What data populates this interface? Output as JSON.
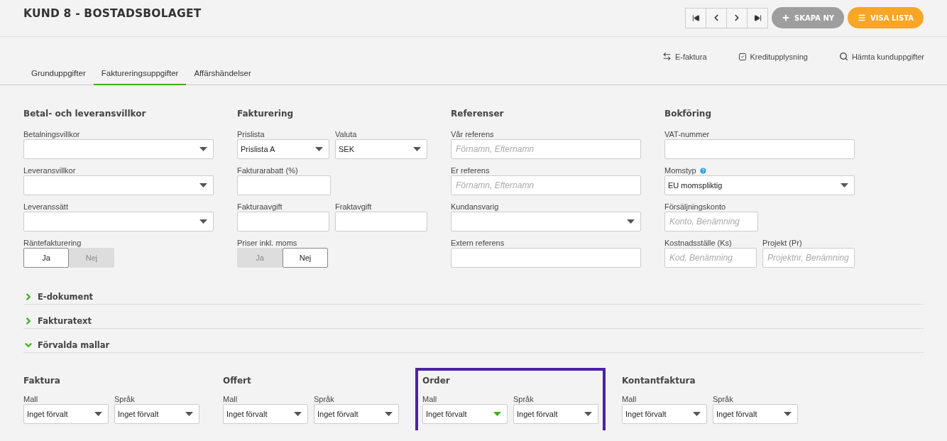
{
  "header": {
    "title": "KUND 8 - BOSTADSBOLAGET",
    "create_button": "SKAPA NY",
    "list_button": "VISA LISTA"
  },
  "actions": [
    {
      "kind": "transfer",
      "label": "E-faktura"
    },
    {
      "kind": "check",
      "label": "Kreditupplysning"
    },
    {
      "kind": "search",
      "label": "Hämta kunduppgifter"
    }
  ],
  "tabs": [
    {
      "label": "Grunduppgifter",
      "selected": false
    },
    {
      "label": "Faktureringsuppgifter",
      "selected": true
    },
    {
      "label": "Affärshändelser",
      "selected": false
    }
  ],
  "sections": [
    {
      "title": "Betal- och leveransvillkor",
      "kind": "single",
      "rows": [
        [
          {
            "label": "Betalningsvillkor",
            "kind": "select"
          }
        ],
        [
          {
            "label": "Leveransvillkor",
            "kind": "select"
          }
        ],
        [
          {
            "label": "Leveranssätt",
            "kind": "select"
          }
        ],
        [
          {
            "label": "Räntefakturering",
            "kind": "toggle",
            "options": [
              {
                "label": "Ja",
                "selected": true
              },
              {
                "label": "Nej",
                "selected": false
              }
            ]
          }
        ]
      ]
    },
    {
      "title": "Fakturering",
      "kind": "double",
      "rows": [
        [
          {
            "label": "Prislista",
            "kind": "select",
            "value": "Prislista A"
          },
          {
            "label": "Valuta",
            "kind": "select",
            "value": "SEK"
          }
        ],
        [
          {
            "label": "Fakturarabatt (%)",
            "kind": "text"
          }
        ],
        [
          {
            "label": "Fakturaavgift",
            "kind": "text"
          },
          {
            "label": "Fraktavgift",
            "kind": "text"
          }
        ],
        [
          {
            "label": "Priser inkl. moms",
            "kind": "toggle",
            "options": [
              {
                "label": "Ja",
                "selected": false
              },
              {
                "label": "Nej",
                "selected": true
              }
            ]
          }
        ]
      ]
    },
    {
      "title": "Referenser",
      "kind": "single",
      "rows": [
        [
          {
            "label": "Vår referens",
            "kind": "text",
            "placeholder": "Förnamn, Efternamn"
          }
        ],
        [
          {
            "label": "Er referens",
            "kind": "text",
            "placeholder": "Förnamn, Efternamn"
          }
        ],
        [
          {
            "label": "Kundansvarig",
            "kind": "select"
          }
        ],
        [
          {
            "label": "Extern referens",
            "kind": "text"
          }
        ]
      ]
    },
    {
      "title": "Bokföring",
      "kind": "double",
      "rows": [
        [
          {
            "label": "VAT-nummer",
            "kind": "text",
            "wide": true
          }
        ],
        [
          {
            "label": "Momstyp",
            "kind": "select",
            "value": "EU momspliktig",
            "help": true,
            "wide": true
          }
        ],
        [
          {
            "label": "Försäljningskonto",
            "kind": "text",
            "placeholder": "Konto, Benämning"
          }
        ],
        [
          {
            "label": "Kostnadsställe (Ks)",
            "kind": "text",
            "placeholder": "Kod, Benämning"
          },
          {
            "label": "Projekt (Pr)",
            "kind": "text",
            "placeholder": "Projektnr, Benämning"
          }
        ]
      ]
    }
  ],
  "accordions": [
    {
      "label": "E-dokument",
      "expanded": false
    },
    {
      "label": "Fakturatext",
      "expanded": false
    },
    {
      "label": "Förvalda mallar",
      "expanded": true
    }
  ],
  "templates": [
    {
      "title": "Faktura",
      "highlighted": false,
      "fields": [
        {
          "label": "Mall",
          "value": "Inget förvalt",
          "focused": false
        },
        {
          "label": "Språk",
          "value": "Inget förvalt",
          "focused": false
        }
      ]
    },
    {
      "title": "Offert",
      "highlighted": false,
      "fields": [
        {
          "label": "Mall",
          "value": "Inget förvalt",
          "focused": false
        },
        {
          "label": "Språk",
          "value": "Inget förvalt",
          "focused": false
        }
      ]
    },
    {
      "title": "Order",
      "highlighted": true,
      "fields": [
        {
          "label": "Mall",
          "value": "Inget förvalt",
          "focused": true
        },
        {
          "label": "Språk",
          "value": "Inget förvalt",
          "focused": false
        }
      ]
    },
    {
      "title": "Kontantfaktura",
      "highlighted": false,
      "fields": [
        {
          "label": "Mall",
          "value": "Inget förvalt",
          "focused": false
        },
        {
          "label": "Språk",
          "value": "Inget förvalt",
          "focused": false
        }
      ]
    }
  ]
}
